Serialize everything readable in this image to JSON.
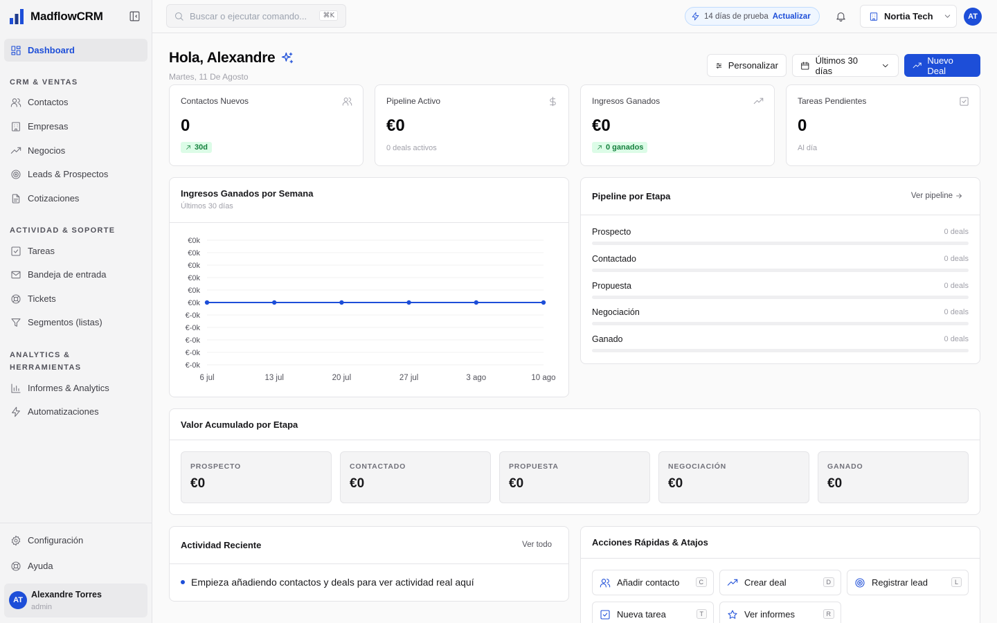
{
  "app": {
    "name": "MadflowCRM",
    "logo_icon": "bar-chart-logo-icon",
    "accent_color": "#1d4ed8"
  },
  "sidebar": {
    "dashboard": "Dashboard",
    "sections": [
      {
        "label": "CRM & VENTAS",
        "items": [
          {
            "label": "Contactos",
            "icon": "users-icon"
          },
          {
            "label": "Empresas",
            "icon": "building-icon"
          },
          {
            "label": "Negocios",
            "icon": "trending-up-icon"
          },
          {
            "label": "Leads & Prospectos",
            "icon": "target-icon"
          },
          {
            "label": "Cotizaciones",
            "icon": "file-icon"
          }
        ]
      },
      {
        "label": "ACTIVIDAD & SOPORTE",
        "items": [
          {
            "label": "Tareas",
            "icon": "check-square-icon"
          },
          {
            "label": "Bandeja de entrada",
            "icon": "mail-icon"
          },
          {
            "label": "Tickets",
            "icon": "lifebuoy-icon"
          },
          {
            "label": "Segmentos (listas)",
            "icon": "filter-icon"
          }
        ]
      },
      {
        "label": "ANALYTICS & HERRAMIENTAS",
        "items": [
          {
            "label": "Informes & Analytics",
            "icon": "bar-chart-icon"
          },
          {
            "label": "Automatizaciones",
            "icon": "zap-icon"
          }
        ]
      }
    ],
    "footer": {
      "settings": "Configuración",
      "help": "Ayuda"
    },
    "user": {
      "initials": "AT",
      "name": "Alexandre Torres",
      "role": "admin"
    }
  },
  "topbar": {
    "search_placeholder": "Buscar o ejecutar comando...",
    "search_shortcut": "⌘K",
    "trial_text": "14 días de prueba",
    "trial_action": "Actualizar",
    "org_name": "Nortia Tech",
    "avatar_initials": "AT"
  },
  "header": {
    "greeting": "Hola, Alexandre",
    "date": "Martes, 11 De Agosto",
    "customize": "Personalizar",
    "date_range": "Últimos 30 días",
    "new_deal": "Nuevo Deal"
  },
  "kpis": [
    {
      "title": "Contactos Nuevos",
      "value": "0",
      "badge": "30d",
      "sub": "",
      "icon": "users-icon"
    },
    {
      "title": "Pipeline Activo",
      "value": "€0",
      "badge": "",
      "sub": "0 deals activos",
      "icon": "dollar-icon"
    },
    {
      "title": "Ingresos Ganados",
      "value": "€0",
      "badge": "0 ganados",
      "sub": "",
      "icon": "trending-up-icon"
    },
    {
      "title": "Tareas Pendientes",
      "value": "0",
      "badge": "",
      "sub": "Al día",
      "icon": "check-square-icon"
    }
  ],
  "weekly_chart": {
    "title": "Ingresos Ganados por Semana",
    "subtitle": "Últimos 30 días"
  },
  "chart_data": {
    "type": "line",
    "title": "Ingresos Ganados por Semana",
    "subtitle": "Últimos 30 días",
    "categories": [
      "6 jul",
      "13 jul",
      "20 jul",
      "27 jul",
      "3 ago",
      "10 ago"
    ],
    "series": [
      {
        "values": [
          0,
          0,
          0,
          0,
          0,
          0
        ]
      }
    ],
    "y_ticks": [
      "€0k",
      "€0k",
      "€0k",
      "€0k",
      "€0k",
      "€0k",
      "€-0k",
      "€-0k",
      "€-0k",
      "€-0k",
      "€-0k"
    ],
    "ylim": [
      -1,
      1
    ],
    "grid": true,
    "line_color": "#1d4ed8"
  },
  "pipeline": {
    "title": "Pipeline por Etapa",
    "link": "Ver pipeline",
    "stages": [
      {
        "name": "Prospecto",
        "count": "0 deals",
        "fraction": 0
      },
      {
        "name": "Contactado",
        "count": "0 deals",
        "fraction": 0
      },
      {
        "name": "Propuesta",
        "count": "0 deals",
        "fraction": 0
      },
      {
        "name": "Negociación",
        "count": "0 deals",
        "fraction": 0
      },
      {
        "name": "Ganado",
        "count": "0 deals",
        "fraction": 0
      }
    ]
  },
  "accumulated": {
    "title": "Valor Acumulado por Etapa",
    "stages": [
      {
        "label": "PROSPECTO",
        "value": "€0"
      },
      {
        "label": "CONTACTADO",
        "value": "€0"
      },
      {
        "label": "PROPUESTA",
        "value": "€0"
      },
      {
        "label": "NEGOCIACIÓN",
        "value": "€0"
      },
      {
        "label": "GANADO",
        "value": "€0"
      }
    ]
  },
  "activity": {
    "title": "Actividad Reciente",
    "link": "Ver todo",
    "empty_text": "Empieza añadiendo contactos y deals para ver actividad real aquí"
  },
  "quick_actions": {
    "title": "Acciones Rápidas & Atajos",
    "items": [
      {
        "label": "Añadir contacto",
        "key": "C",
        "icon": "users-icon"
      },
      {
        "label": "Crear deal",
        "key": "D",
        "icon": "trending-up-icon"
      },
      {
        "label": "Registrar lead",
        "key": "L",
        "icon": "target-icon"
      },
      {
        "label": "Nueva tarea",
        "key": "T",
        "icon": "check-square-icon"
      },
      {
        "label": "Ver informes",
        "key": "R",
        "icon": "star-icon"
      }
    ]
  }
}
